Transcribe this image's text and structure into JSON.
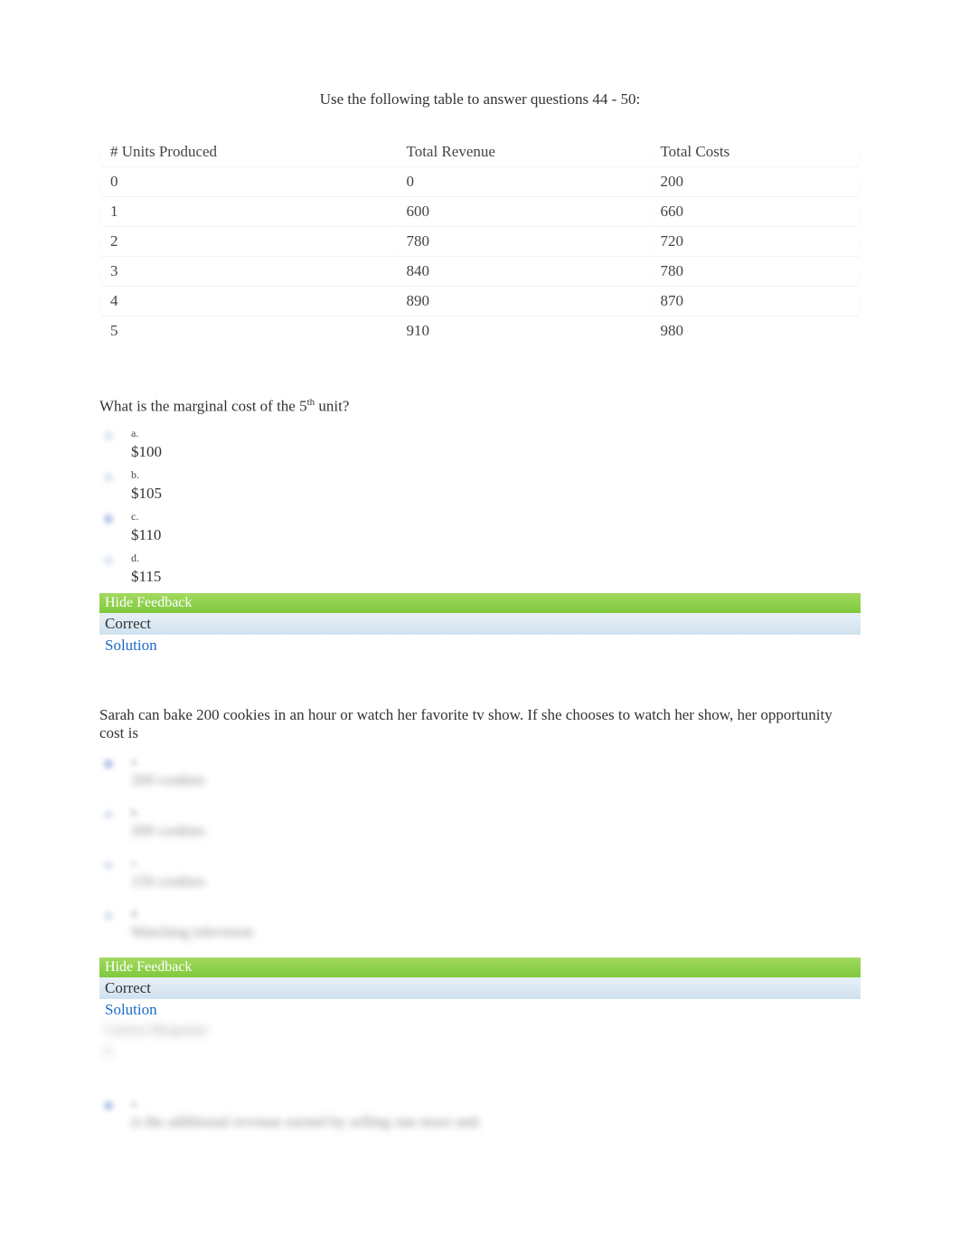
{
  "instruction": "Use the following table to answer questions 44 - 50:",
  "table": {
    "headers": [
      "# Units Produced",
      "Total Revenue",
      "Total Costs"
    ],
    "rows": [
      [
        "0",
        "0",
        "200"
      ],
      [
        "1",
        "600",
        "660"
      ],
      [
        "2",
        "780",
        "720"
      ],
      [
        "3",
        "840",
        "780"
      ],
      [
        "4",
        "890",
        "870"
      ],
      [
        "5",
        "910",
        "980"
      ]
    ]
  },
  "q1": {
    "text_prefix": "What is the marginal cost of the 5",
    "text_sup": "th",
    "text_suffix": " unit?",
    "options": [
      {
        "letter": "a.",
        "text": "$100"
      },
      {
        "letter": "b.",
        "text": "$105"
      },
      {
        "letter": "c.",
        "text": "$110"
      },
      {
        "letter": "d.",
        "text": "$115"
      }
    ],
    "feedback_label": "Hide Feedback",
    "correct_label": "Correct",
    "solution_label": "Solution"
  },
  "q2": {
    "text": "Sarah can bake 200 cookies in an hour or watch her favorite tv show. If she chooses to watch her show, her opportunity cost is",
    "options": [
      {
        "letter": "a.",
        "text": "200 cookies"
      },
      {
        "letter": "b.",
        "text": "200 cookies"
      },
      {
        "letter": "c.",
        "text": "150 cookies"
      },
      {
        "letter": "d.",
        "text": "Watching television"
      }
    ],
    "feedback_label": "Hide Feedback",
    "correct_label": "Correct",
    "solution_label": "Solution",
    "blur_label": "Correct Response",
    "blur_letter": "a"
  },
  "extra": {
    "letter": "a.",
    "text": "is the additional revenue earned by selling one more unit"
  }
}
